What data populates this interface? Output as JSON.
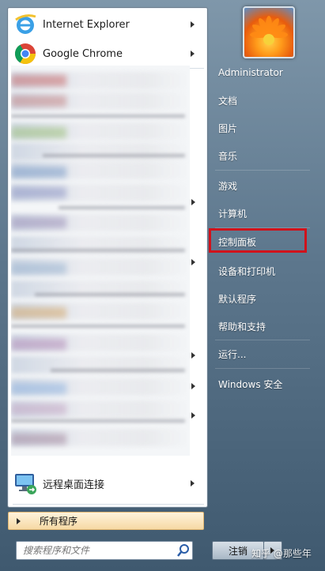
{
  "pinned": [
    {
      "label": "Internet Explorer",
      "icon": "internet-explorer-icon"
    },
    {
      "label": "Google Chrome",
      "icon": "google-chrome-icon"
    }
  ],
  "recent": {
    "remote_desktop": {
      "label": "远程桌面连接",
      "icon": "remote-desktop-icon"
    }
  },
  "all_programs": {
    "label": "所有程序"
  },
  "search": {
    "placeholder": "搜索程序和文件"
  },
  "right_menu": [
    {
      "label": "Administrator"
    },
    {
      "label": "文档"
    },
    {
      "label": "图片"
    },
    {
      "label": "音乐"
    },
    {
      "label": "游戏"
    },
    {
      "label": "计算机"
    },
    {
      "label": "控制面板"
    },
    {
      "label": "设备和打印机"
    },
    {
      "label": "默认程序"
    },
    {
      "label": "帮助和支持"
    },
    {
      "label": "运行..."
    },
    {
      "label": "Windows 安全"
    }
  ],
  "shutdown": {
    "label": "注销"
  },
  "watermark": "知乎 @那些年",
  "colors": {
    "highlight": "#d0121b",
    "all_programs_bg": "#f6d9a4"
  }
}
